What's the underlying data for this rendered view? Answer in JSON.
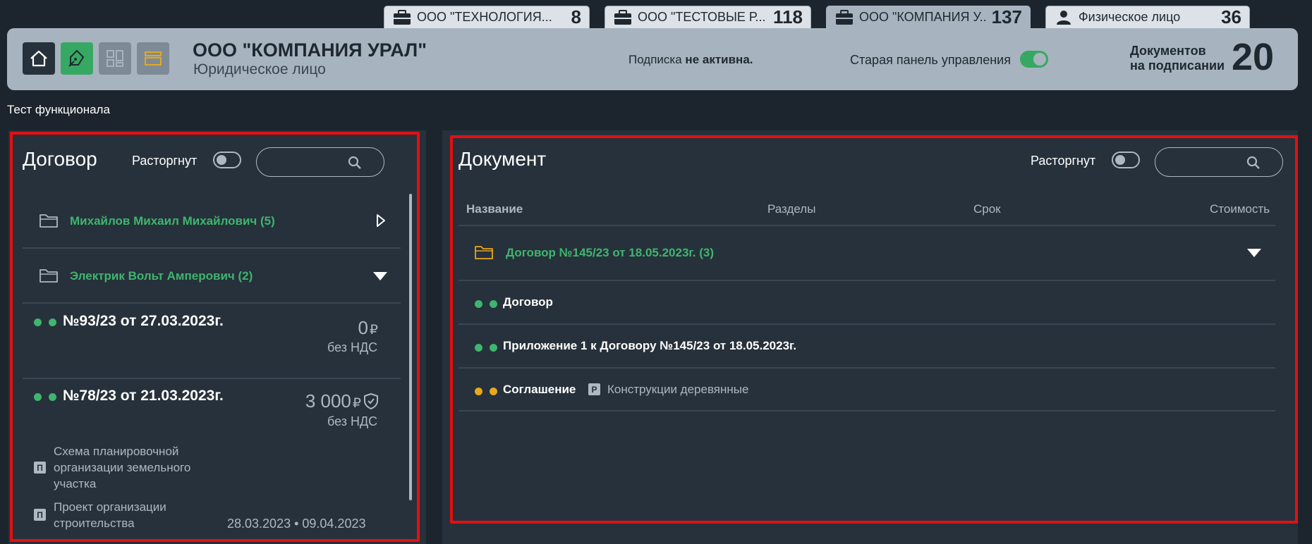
{
  "tabs": [
    {
      "name": "ООО \"ТЕХНОЛОГИЯ...",
      "count": "8",
      "icon": "briefcase-icon"
    },
    {
      "name": "ООО \"ТЕСТОВЫЕ Р...",
      "count": "118",
      "icon": "briefcase-icon"
    },
    {
      "name": "ООО \"КОМПАНИЯ У...",
      "count": "137",
      "icon": "briefcase-icon",
      "active": true
    },
    {
      "name": "Физическое лицо",
      "count": "36",
      "icon": "person-icon"
    }
  ],
  "header": {
    "org_name": "ООО \"КОМПАНИЯ УРАЛ\"",
    "org_type": "Юридическое лицо",
    "subscription_prefix": "Подписка",
    "subscription_status": "не активна.",
    "old_panel_label": "Старая панель управления",
    "docs_label_line1": "Документов",
    "docs_label_line2": "на подписании",
    "docs_count": "20",
    "colors": {
      "home": "#26313b",
      "pen": "#37a863",
      "grid": "#7e8b96",
      "stack": "#7e8b96"
    }
  },
  "page_title": "Тест функционала",
  "left_panel": {
    "title": "Договор",
    "toggle_label": "Расторгнут",
    "search_placeholder": "",
    "groups": [
      {
        "name": "Михайлов Михаил Михайлович (5)",
        "arrow": "play-icon"
      },
      {
        "name": "Электрик Вольт Амперович (2)",
        "arrow": "caret-down-icon"
      }
    ],
    "contracts": [
      {
        "number": "№93/23 от 27.03.2023г.",
        "amount": "0",
        "currency": "₽",
        "nds": "без НДС"
      },
      {
        "number": "№78/23 от 21.03.2023г.",
        "amount": "3 000",
        "currency": "₽",
        "nds": "без НДС"
      }
    ],
    "stages": [
      {
        "badge": "П",
        "text_line1": "Схема планировочной",
        "text_line2": "организации земельного",
        "text_line3": "участка"
      },
      {
        "badge": "П",
        "text_line1": "Проект организации",
        "text_line2": "строительства"
      }
    ],
    "dates": "28.03.2023 • 09.04.2023"
  },
  "right_panel": {
    "title": "Документ",
    "toggle_label": "Расторгнут",
    "search_placeholder": "",
    "columns": [
      "Название",
      "Разделы",
      "Срок",
      "Стоимость"
    ],
    "folder": "Договор №145/23 от 18.05.2023г. (3)",
    "documents": [
      {
        "name": "Договор",
        "dot_color": "#3fb56e",
        "section_badge": "",
        "section": ""
      },
      {
        "name": "Приложение 1 к Договору №145/23 от 18.05.2023г.",
        "dot_color": "#3fb56e",
        "section_badge": "",
        "section": ""
      },
      {
        "name": "Соглашение",
        "dot_color": "#e9a71e",
        "section_badge": "Р",
        "section": "Конструкции деревянные"
      }
    ]
  },
  "colors": {
    "green": "#3fb56e",
    "orange": "#e9a71e",
    "highlight": "#e31010"
  }
}
